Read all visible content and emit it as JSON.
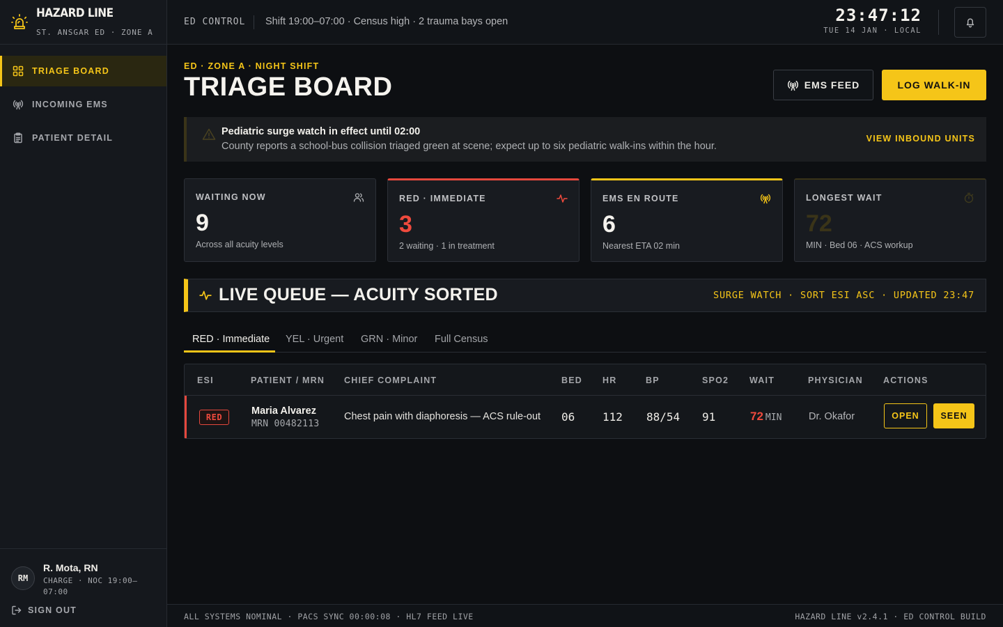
{
  "brand": {
    "name": "HAZARD LINE",
    "subtitle": "ST. ANSGAR ED · ZONE A"
  },
  "nav": [
    {
      "label": "TRIAGE BOARD",
      "icon": "grid-icon",
      "active": true
    },
    {
      "label": "INCOMING EMS",
      "icon": "broadcast-icon",
      "active": false
    },
    {
      "label": "PATIENT DETAIL",
      "icon": "clipboard-icon",
      "active": false
    }
  ],
  "user": {
    "initials": "RM",
    "name": "R. Mota, RN",
    "role": "CHARGE · NOC 19:00–07:00",
    "signout": "SIGN OUT"
  },
  "topbar": {
    "context": "ED CONTROL",
    "shift": "Shift 19:00–07:00 · Census high · 2 trauma bays open",
    "time": "23:47:12",
    "date": "TUE 14 JAN · LOCAL"
  },
  "header": {
    "eyebrow": "ED · ZONE A · NIGHT SHIFT",
    "title": "TRIAGE BOARD",
    "ems_button": "EMS FEED",
    "walkin_button": "LOG WALK-IN"
  },
  "alert": {
    "title": "Pediatric surge watch in effect until 02:00",
    "text": "County reports a school-bus collision triaged green at scene; expect up to six pediatric walk-ins within the hour.",
    "link": "VIEW INBOUND UNITS"
  },
  "stats": [
    {
      "label": "WAITING NOW",
      "value": "9",
      "sub": "Across all acuity levels",
      "icon": "users-icon"
    },
    {
      "label": "RED · IMMEDIATE",
      "value": "3",
      "sub": "2 waiting · 1 in treatment",
      "icon": "pulse-icon"
    },
    {
      "label": "EMS EN ROUTE",
      "value": "6",
      "sub": "Nearest ETA 02 min",
      "icon": "broadcast-icon"
    },
    {
      "label": "LONGEST WAIT",
      "value": "72",
      "sub": "MIN · Bed 06 · ACS workup",
      "icon": "timer-icon"
    }
  ],
  "section": {
    "title": "LIVE QUEUE — ACUITY SORTED",
    "meta": "SURGE WATCH · SORT ESI ASC · UPDATED 23:47"
  },
  "tabs": [
    "RED · Immediate",
    "YEL · Urgent",
    "GRN · Minor",
    "Full Census"
  ],
  "table": {
    "columns": [
      "ESI",
      "PATIENT / MRN",
      "CHIEF COMPLAINT",
      "BED",
      "HR",
      "BP",
      "SPO2",
      "WAIT",
      "PHYSICIAN",
      "ACTIONS"
    ],
    "rows": [
      {
        "esi": "RED",
        "name": "Maria Alvarez",
        "mrn": "MRN 00482113",
        "complaint": "Chest pain with diaphoresis — ACS rule-out",
        "bed": "06",
        "hr": "112",
        "bp": "88/54",
        "spo2": "91",
        "wait": "72",
        "wait_unit": "MIN",
        "physician": "Dr. Okafor",
        "open": "OPEN",
        "seen": "SEEN"
      }
    ]
  },
  "footer": {
    "left": "ALL SYSTEMS NOMINAL · PACS SYNC 00:00:08 · HL7 FEED LIVE",
    "right": "HAZARD LINE v2.4.1 · ED CONTROL BUILD"
  },
  "colors": {
    "accent": "#f5c518",
    "danger": "#ef4a3d",
    "background": "#0d0f12"
  }
}
